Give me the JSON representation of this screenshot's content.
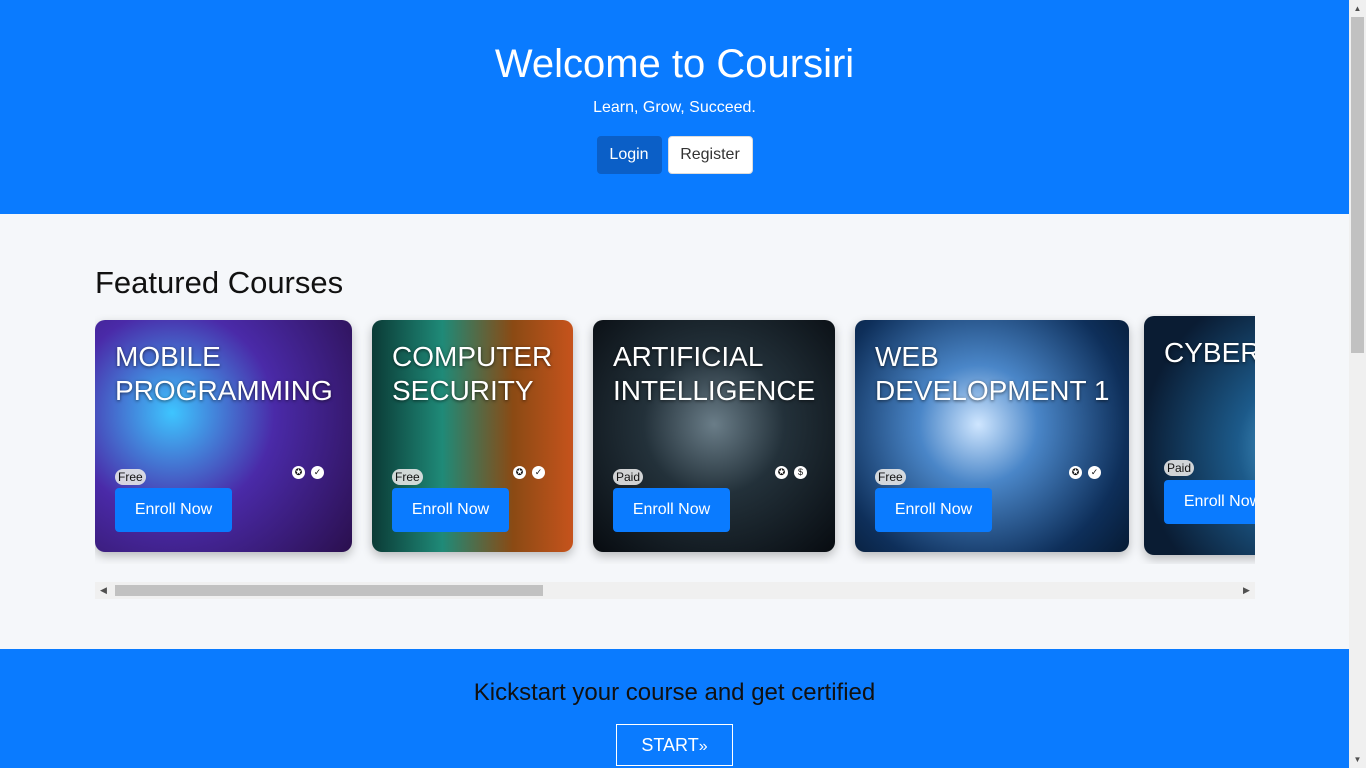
{
  "hero": {
    "title": "Welcome to Coursiri",
    "tagline": "Learn, Grow, Succeed.",
    "login_label": "Login",
    "register_label": "Register"
  },
  "featured": {
    "heading": "Featured Courses",
    "courses": [
      {
        "title": "Mobile Programming",
        "price_badge": "Free",
        "enroll_label": "Enroll Now",
        "icons": [
          "certificate-icon",
          "check-circle-icon"
        ]
      },
      {
        "title": "Computer Security",
        "price_badge": "Free",
        "enroll_label": "Enroll Now",
        "icons": [
          "certificate-icon",
          "check-circle-icon"
        ]
      },
      {
        "title": "Artificial Intelligence",
        "price_badge": "Paid",
        "enroll_label": "Enroll Now",
        "icons": [
          "certificate-icon",
          "dollar-circle-icon"
        ]
      },
      {
        "title": "Web Development 1",
        "price_badge": "Free",
        "enroll_label": "Enroll Now",
        "icons": [
          "certificate-icon",
          "check-circle-icon"
        ]
      },
      {
        "title": "Cyber",
        "price_badge": "Paid",
        "enroll_label": "Enroll Now",
        "icons": []
      }
    ]
  },
  "cta": {
    "text": "Kickstart your course and get certified",
    "start_label": "START",
    "start_icon": "double-chevron-right-icon"
  },
  "colors": {
    "primary": "#0a7bff",
    "login_button": "#0b5fc7",
    "page_background": "#f5f7fa"
  }
}
